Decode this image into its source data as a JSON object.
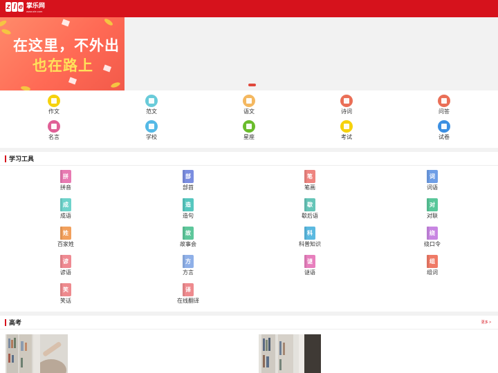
{
  "header": {
    "brand": "掌乐网",
    "logo_mark": [
      "z",
      "l",
      "e"
    ],
    "url": "www.zle.com"
  },
  "banner": {
    "line1": "在这里，不外出",
    "line2": "也在路上"
  },
  "quick_nav": [
    {
      "label": "作文",
      "color": "#f6d20d"
    },
    {
      "label": "范文",
      "color": "#69cbd9"
    },
    {
      "label": "语文",
      "color": "#f4b860"
    },
    {
      "label": "诗词",
      "color": "#ea6f57"
    },
    {
      "label": "问答",
      "color": "#ea6f57"
    },
    {
      "label": "名言",
      "color": "#e05f96"
    },
    {
      "label": "学校",
      "color": "#54b9e6"
    },
    {
      "label": "星座",
      "color": "#6abc2c"
    },
    {
      "label": "考试",
      "color": "#f6d20d"
    },
    {
      "label": "试卷",
      "color": "#3b8fe2"
    }
  ],
  "tools_section": {
    "title": "学习工具"
  },
  "tools": [
    {
      "glyph": "拼",
      "label": "拼音",
      "color": "#e87ab2"
    },
    {
      "glyph": "部",
      "label": "部首",
      "color": "#7b8ee0"
    },
    {
      "glyph": "笔",
      "label": "笔画",
      "color": "#ee8580"
    },
    {
      "glyph": "词",
      "label": "词语",
      "color": "#6e9ee6"
    },
    {
      "glyph": "成",
      "label": "成语",
      "color": "#6fd3cb"
    },
    {
      "glyph": "造",
      "label": "造句",
      "color": "#56c7bf"
    },
    {
      "glyph": "歇",
      "label": "歇后语",
      "color": "#66c5b8"
    },
    {
      "glyph": "对",
      "label": "对联",
      "color": "#59c79a"
    },
    {
      "glyph": "姓",
      "label": "百家姓",
      "color": "#f2a05c"
    },
    {
      "glyph": "故",
      "label": "故事会",
      "color": "#5ec79b"
    },
    {
      "glyph": "科",
      "label": "科普知识",
      "color": "#5bb9e0"
    },
    {
      "glyph": "绕",
      "label": "绕口令",
      "color": "#c886e2"
    },
    {
      "glyph": "谚",
      "label": "谚语",
      "color": "#ef8a92"
    },
    {
      "glyph": "方",
      "label": "方言",
      "color": "#8fb0e8"
    },
    {
      "glyph": "谜",
      "label": "谜语",
      "color": "#e77fbd"
    },
    {
      "glyph": "组",
      "label": "组词",
      "color": "#ef7a66"
    },
    {
      "glyph": "笑",
      "label": "笑话",
      "color": "#ee8a8e"
    },
    {
      "glyph": "译",
      "label": "在线翻译",
      "color": "#ee8a8e"
    }
  ],
  "gaokao_section": {
    "title": "高考",
    "more": "更多 >"
  }
}
